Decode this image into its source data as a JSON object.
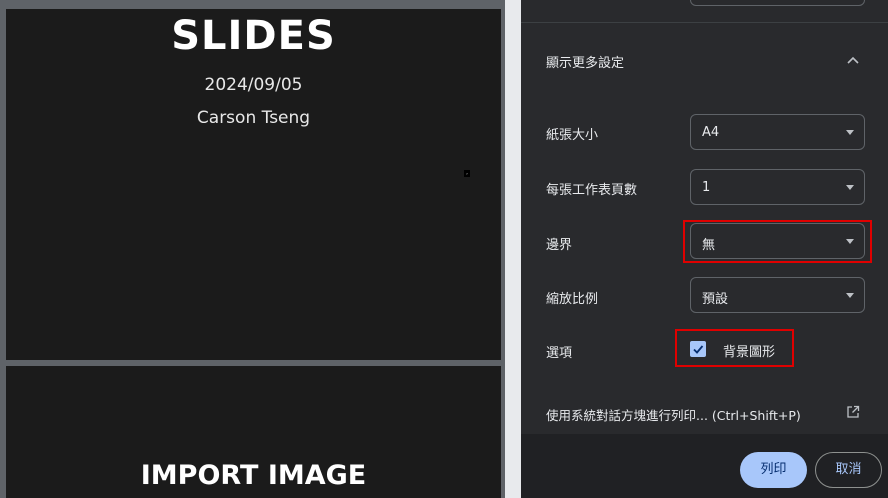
{
  "preview": {
    "slide1": {
      "title": "SLIDES",
      "date": "2024/09/05",
      "author": "Carson Tseng",
      "mark": ","
    },
    "slide2": {
      "title": "IMPORT IMAGE"
    }
  },
  "settings": {
    "more_settings_label": "顯示更多設定",
    "paper_size": {
      "label": "紙張大小",
      "value": "A4"
    },
    "sheets_per_page": {
      "label": "每張工作表頁數",
      "value": "1"
    },
    "margins": {
      "label": "邊界",
      "value": "無"
    },
    "scale": {
      "label": "縮放比例",
      "value": "預設"
    },
    "options": {
      "label": "選項",
      "background_graphics_label": "背景圖形",
      "background_graphics_checked": true
    },
    "system_dialog_link": "使用系統對話方塊進行列印... (Ctrl+Shift+P)"
  },
  "footer": {
    "print_label": "列印",
    "cancel_label": "取消"
  },
  "colors": {
    "accent": "#a8c7fa",
    "highlight_border": "#e00000",
    "panel_bg": "#292a2d"
  },
  "icons": {
    "collapse": "chevron-up-icon",
    "dropdown": "caret-down-icon",
    "checkbox": "check-icon",
    "external": "open-in-new-icon"
  }
}
